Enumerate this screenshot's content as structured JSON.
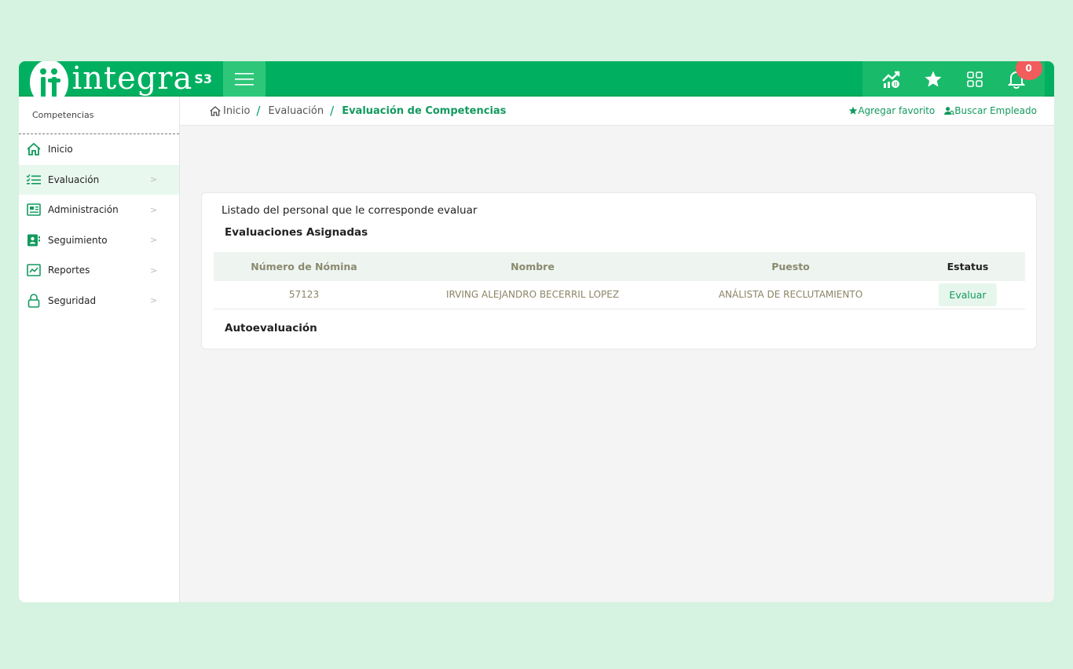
{
  "header": {
    "logo_text": "integra",
    "logo_suffix": "S3",
    "notification_count": "0",
    "icons": [
      "trend-grid-icon",
      "star-icon",
      "apps-grid-icon",
      "bell-icon"
    ]
  },
  "sidebar": {
    "title": "Competencias",
    "items": [
      {
        "label": "Inicio",
        "icon": "home-icon"
      },
      {
        "label": "Evaluación",
        "icon": "checklist-icon",
        "active": true
      },
      {
        "label": "Administración",
        "icon": "newspaper-icon"
      },
      {
        "label": "Seguimiento",
        "icon": "contact-card-icon"
      },
      {
        "label": "Reportes",
        "icon": "chart-line-icon"
      },
      {
        "label": "Seguridad",
        "icon": "lock-icon"
      }
    ]
  },
  "breadcrumb": {
    "home": "Inicio",
    "level1": "Evaluación",
    "current": "Evaluación de Competencias",
    "sep": "/",
    "add_favorite": "Agregar favorito",
    "search_employee": "Buscar Empleado"
  },
  "main": {
    "card_title": "Listado del personal que le corresponde evaluar",
    "assigned_title": "Evaluaciones Asignadas",
    "self_title": "Autoevaluación",
    "table": {
      "headers": [
        "Número de Nómina",
        "Nombre",
        "Puesto",
        "Estatus"
      ],
      "rows": [
        {
          "nomina": "57123",
          "nombre": "IRVING ALEJANDRO BECERRIL LOPEZ",
          "puesto": "ANÁLISTA DE RECLUTAMIENTO",
          "action": "Evaluar"
        }
      ]
    }
  },
  "colors": {
    "brand_green": "#00b060",
    "accent_text": "#129a5e",
    "badge_red": "#f25c5c",
    "background": "#d6f2e1"
  }
}
